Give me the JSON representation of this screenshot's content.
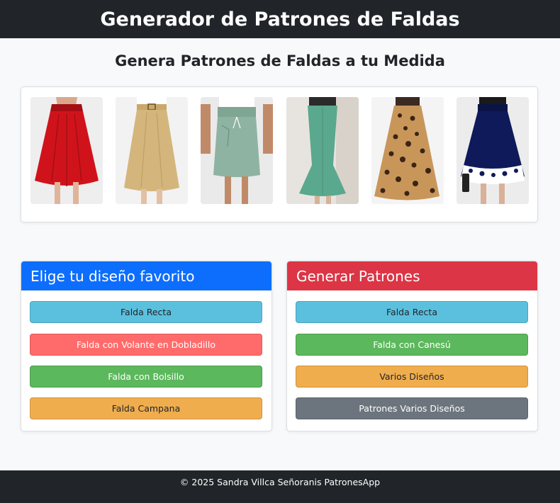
{
  "header": {
    "title": "Generador de Patrones de Faldas"
  },
  "main": {
    "subtitle": "Genera Patrones de Faldas a tu Medida"
  },
  "gallery": [
    {
      "name": "skirt-red-flare",
      "color": "#d0131b"
    },
    {
      "name": "skirt-khaki-belt",
      "color": "#d4b67c"
    },
    {
      "name": "skirt-sage-pocket",
      "color": "#8fb3a2"
    },
    {
      "name": "skirt-teal-mermaid",
      "color": "#5aa88e"
    },
    {
      "name": "skirt-leopard-maxi",
      "color": "#9b6a36"
    },
    {
      "name": "skirt-navy-floral",
      "color": "#0f1a5a"
    }
  ],
  "design_card": {
    "title": "Elige tu diseño favorito",
    "header_color": "#0d6efd",
    "buttons": [
      {
        "label": "Falda Recta",
        "color": "#5bc0de"
      },
      {
        "label": "Falda con Volante en Dobladillo",
        "color": "#ff6b6b"
      },
      {
        "label": "Falda con Bolsillo",
        "color": "#5cb85c"
      },
      {
        "label": "Falda Campana",
        "color": "#f0ad4e"
      }
    ]
  },
  "pattern_card": {
    "title": "Generar Patrones",
    "header_color": "#dc3545",
    "buttons": [
      {
        "label": "Falda Recta",
        "color": "#5bc0de"
      },
      {
        "label": "Falda con Canesú",
        "color": "#5cb85c"
      },
      {
        "label": "Varios Diseños",
        "color": "#f0ad4e"
      },
      {
        "label": "Patrones Varios Diseños",
        "color": "#6c757d"
      }
    ]
  },
  "footer": {
    "text": "© 2025 Sandra Villca Señoranis PatronesApp"
  }
}
